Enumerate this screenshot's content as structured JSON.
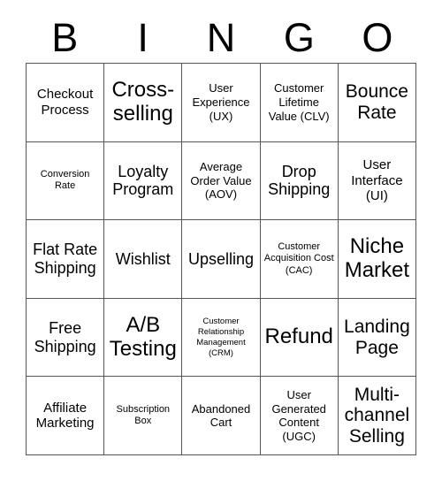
{
  "card": {
    "title": "BINGO",
    "columns": [
      "B",
      "I",
      "N",
      "G",
      "O"
    ],
    "grid_size": "5x5",
    "border_color": "#555555",
    "text_color": "#000000",
    "background_color": "#ffffff"
  },
  "header": {
    "letters": [
      {
        "label": "B"
      },
      {
        "label": "I"
      },
      {
        "label": "N"
      },
      {
        "label": "G"
      },
      {
        "label": "O"
      }
    ]
  },
  "rows": [
    {
      "cells": [
        {
          "label": "Checkout Process",
          "size": "sm"
        },
        {
          "label": "Cross-selling",
          "size": "xl"
        },
        {
          "label": "User Experience (UX)",
          "size": "xs"
        },
        {
          "label": "Customer Lifetime Value (CLV)",
          "size": "xs"
        },
        {
          "label": "Bounce Rate",
          "size": "lg"
        }
      ]
    },
    {
      "cells": [
        {
          "label": "Conversion Rate",
          "size": "xxs"
        },
        {
          "label": "Loyalty Program",
          "size": "md"
        },
        {
          "label": "Average Order Value (AOV)",
          "size": "xs"
        },
        {
          "label": "Drop Shipping",
          "size": "md"
        },
        {
          "label": "User Interface (UI)",
          "size": "sm"
        }
      ]
    },
    {
      "cells": [
        {
          "label": "Flat Rate Shipping",
          "size": "md"
        },
        {
          "label": "Wishlist",
          "size": "md"
        },
        {
          "label": "Upselling",
          "size": "md"
        },
        {
          "label": "Customer Acquisition Cost (CAC)",
          "size": "xxs"
        },
        {
          "label": "Niche Market",
          "size": "xl"
        }
      ]
    },
    {
      "cells": [
        {
          "label": "Free Shipping",
          "size": "md"
        },
        {
          "label": "A/B Testing",
          "size": "xl"
        },
        {
          "label": "Customer Relationship Management (CRM)",
          "size": "tiny"
        },
        {
          "label": "Refund",
          "size": "xl"
        },
        {
          "label": "Landing Page",
          "size": "lg"
        }
      ]
    },
    {
      "cells": [
        {
          "label": "Affiliate Marketing",
          "size": "sm"
        },
        {
          "label": "Subscription Box",
          "size": "xxs"
        },
        {
          "label": "Abandoned Cart",
          "size": "xs"
        },
        {
          "label": "User Generated Content (UGC)",
          "size": "xs"
        },
        {
          "label": "Multi-channel Selling",
          "size": "lg"
        }
      ]
    }
  ]
}
